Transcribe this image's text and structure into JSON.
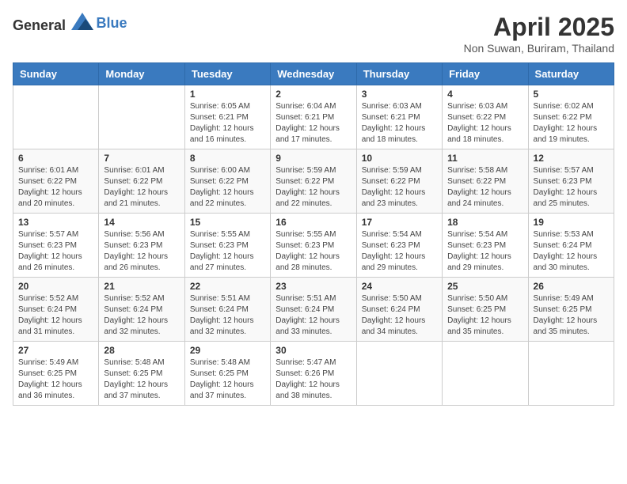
{
  "header": {
    "logo_general": "General",
    "logo_blue": "Blue",
    "title": "April 2025",
    "subtitle": "Non Suwan, Buriram, Thailand"
  },
  "weekdays": [
    "Sunday",
    "Monday",
    "Tuesday",
    "Wednesday",
    "Thursday",
    "Friday",
    "Saturday"
  ],
  "weeks": [
    [
      {
        "day": "",
        "info": ""
      },
      {
        "day": "",
        "info": ""
      },
      {
        "day": "1",
        "info": "Sunrise: 6:05 AM\nSunset: 6:21 PM\nDaylight: 12 hours and 16 minutes."
      },
      {
        "day": "2",
        "info": "Sunrise: 6:04 AM\nSunset: 6:21 PM\nDaylight: 12 hours and 17 minutes."
      },
      {
        "day": "3",
        "info": "Sunrise: 6:03 AM\nSunset: 6:21 PM\nDaylight: 12 hours and 18 minutes."
      },
      {
        "day": "4",
        "info": "Sunrise: 6:03 AM\nSunset: 6:22 PM\nDaylight: 12 hours and 18 minutes."
      },
      {
        "day": "5",
        "info": "Sunrise: 6:02 AM\nSunset: 6:22 PM\nDaylight: 12 hours and 19 minutes."
      }
    ],
    [
      {
        "day": "6",
        "info": "Sunrise: 6:01 AM\nSunset: 6:22 PM\nDaylight: 12 hours and 20 minutes."
      },
      {
        "day": "7",
        "info": "Sunrise: 6:01 AM\nSunset: 6:22 PM\nDaylight: 12 hours and 21 minutes."
      },
      {
        "day": "8",
        "info": "Sunrise: 6:00 AM\nSunset: 6:22 PM\nDaylight: 12 hours and 22 minutes."
      },
      {
        "day": "9",
        "info": "Sunrise: 5:59 AM\nSunset: 6:22 PM\nDaylight: 12 hours and 22 minutes."
      },
      {
        "day": "10",
        "info": "Sunrise: 5:59 AM\nSunset: 6:22 PM\nDaylight: 12 hours and 23 minutes."
      },
      {
        "day": "11",
        "info": "Sunrise: 5:58 AM\nSunset: 6:22 PM\nDaylight: 12 hours and 24 minutes."
      },
      {
        "day": "12",
        "info": "Sunrise: 5:57 AM\nSunset: 6:23 PM\nDaylight: 12 hours and 25 minutes."
      }
    ],
    [
      {
        "day": "13",
        "info": "Sunrise: 5:57 AM\nSunset: 6:23 PM\nDaylight: 12 hours and 26 minutes."
      },
      {
        "day": "14",
        "info": "Sunrise: 5:56 AM\nSunset: 6:23 PM\nDaylight: 12 hours and 26 minutes."
      },
      {
        "day": "15",
        "info": "Sunrise: 5:55 AM\nSunset: 6:23 PM\nDaylight: 12 hours and 27 minutes."
      },
      {
        "day": "16",
        "info": "Sunrise: 5:55 AM\nSunset: 6:23 PM\nDaylight: 12 hours and 28 minutes."
      },
      {
        "day": "17",
        "info": "Sunrise: 5:54 AM\nSunset: 6:23 PM\nDaylight: 12 hours and 29 minutes."
      },
      {
        "day": "18",
        "info": "Sunrise: 5:54 AM\nSunset: 6:23 PM\nDaylight: 12 hours and 29 minutes."
      },
      {
        "day": "19",
        "info": "Sunrise: 5:53 AM\nSunset: 6:24 PM\nDaylight: 12 hours and 30 minutes."
      }
    ],
    [
      {
        "day": "20",
        "info": "Sunrise: 5:52 AM\nSunset: 6:24 PM\nDaylight: 12 hours and 31 minutes."
      },
      {
        "day": "21",
        "info": "Sunrise: 5:52 AM\nSunset: 6:24 PM\nDaylight: 12 hours and 32 minutes."
      },
      {
        "day": "22",
        "info": "Sunrise: 5:51 AM\nSunset: 6:24 PM\nDaylight: 12 hours and 32 minutes."
      },
      {
        "day": "23",
        "info": "Sunrise: 5:51 AM\nSunset: 6:24 PM\nDaylight: 12 hours and 33 minutes."
      },
      {
        "day": "24",
        "info": "Sunrise: 5:50 AM\nSunset: 6:24 PM\nDaylight: 12 hours and 34 minutes."
      },
      {
        "day": "25",
        "info": "Sunrise: 5:50 AM\nSunset: 6:25 PM\nDaylight: 12 hours and 35 minutes."
      },
      {
        "day": "26",
        "info": "Sunrise: 5:49 AM\nSunset: 6:25 PM\nDaylight: 12 hours and 35 minutes."
      }
    ],
    [
      {
        "day": "27",
        "info": "Sunrise: 5:49 AM\nSunset: 6:25 PM\nDaylight: 12 hours and 36 minutes."
      },
      {
        "day": "28",
        "info": "Sunrise: 5:48 AM\nSunset: 6:25 PM\nDaylight: 12 hours and 37 minutes."
      },
      {
        "day": "29",
        "info": "Sunrise: 5:48 AM\nSunset: 6:25 PM\nDaylight: 12 hours and 37 minutes."
      },
      {
        "day": "30",
        "info": "Sunrise: 5:47 AM\nSunset: 6:26 PM\nDaylight: 12 hours and 38 minutes."
      },
      {
        "day": "",
        "info": ""
      },
      {
        "day": "",
        "info": ""
      },
      {
        "day": "",
        "info": ""
      }
    ]
  ]
}
